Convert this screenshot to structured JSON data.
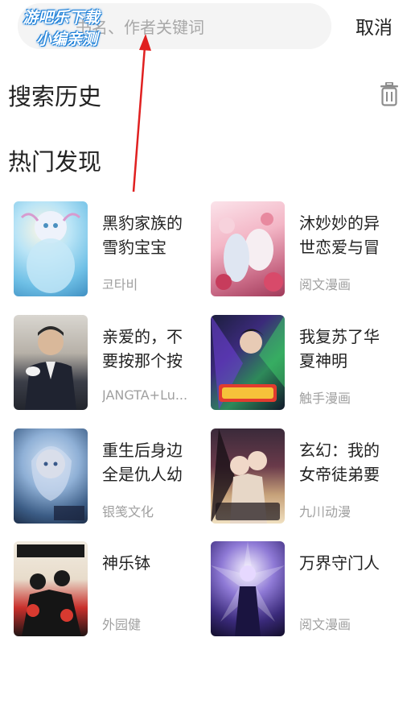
{
  "search": {
    "placeholder": "书名、作者关键词"
  },
  "header": {
    "cancel_label": "取消"
  },
  "watermark": {
    "line1": "游吧乐下载",
    "line2": "小编亲测"
  },
  "history": {
    "title": "搜索历史"
  },
  "hot": {
    "title": "热门发现",
    "items": [
      {
        "title": "黑豹家族的雪豹宝宝",
        "author": "코타비"
      },
      {
        "title": "沐妙妙的异世恋爱与冒",
        "author": "阅文漫画"
      },
      {
        "title": "亲爱的，不要按那个按",
        "author": "JANGTA+Lu..."
      },
      {
        "title": "我复苏了华夏神明",
        "author": "触手漫画"
      },
      {
        "title": "重生后身边全是仇人幼",
        "author": "银笺文化"
      },
      {
        "title": "玄幻：我的女帝徒弟要",
        "author": "九川动漫"
      },
      {
        "title": "神乐钵",
        "author": "外园健"
      },
      {
        "title": "万界守门人",
        "author": "阅文漫画"
      }
    ]
  },
  "colors": {
    "search_bg": "#f4f4f4",
    "arrow": "#e02020",
    "watermark_stroke": "#1b7fd8"
  }
}
